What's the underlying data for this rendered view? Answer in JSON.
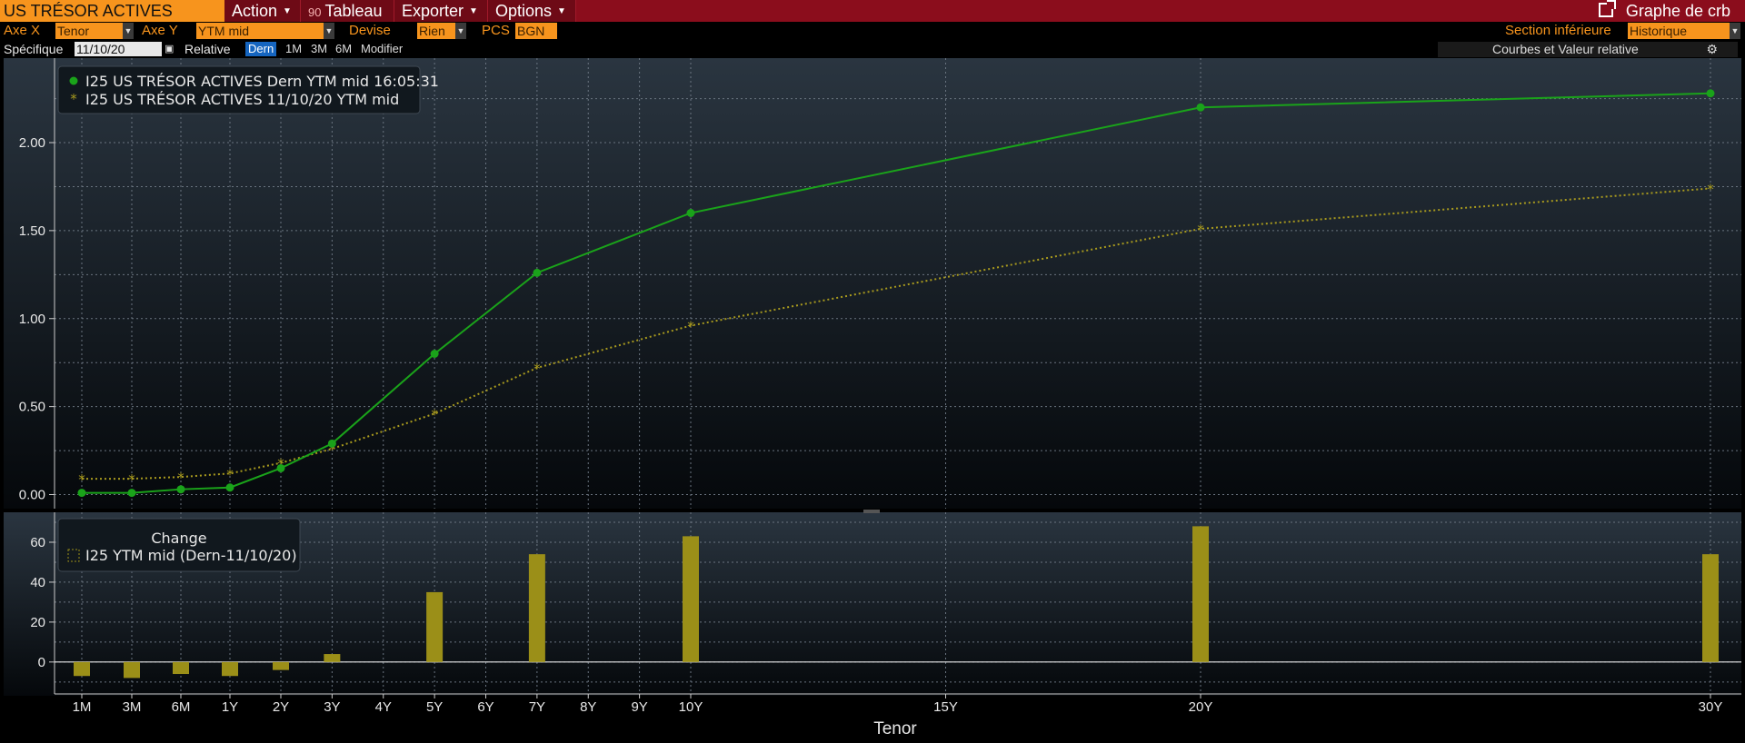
{
  "app": {
    "title": "US TRÉSOR ACTIVES",
    "menu": [
      {
        "label": "Action",
        "caret": true
      },
      {
        "label": "Tableau",
        "prefix": "90",
        "caret": false
      },
      {
        "label": "Exporter",
        "caret": true
      },
      {
        "label": "Options",
        "caret": true
      }
    ],
    "graph_link": "Graphe de crb"
  },
  "controls": {
    "axe_x_label": "Axe X",
    "axe_x_value": "Tenor",
    "axe_y_label": "Axe Y",
    "axe_y_value": "YTM mid",
    "devise_label": "Devise",
    "devise_value": "Rien",
    "pcs_label": "PCS",
    "pcs_value": "BGN",
    "section_label": "Section inférieure",
    "section_value": "Historique",
    "specifique_label": "Spécifique",
    "date_value": "11/10/20",
    "relative_label": "Relative",
    "relative_options": [
      "Dern",
      "1M",
      "3M",
      "6M",
      "Modifier"
    ],
    "relative_selected": "Dern",
    "collapse_glyph": "«",
    "right_panel_label": "Courbes et Valeur relative",
    "gear_icon": "gear-icon"
  },
  "colors": {
    "series_current": "#1aa31a",
    "series_historic": "#a89a1e",
    "bars": "#9b8f18",
    "accent": "#f7941d",
    "titlebar": "#8b0d1c"
  },
  "chart_data": [
    {
      "type": "line",
      "x": [
        "1M",
        "3M",
        "6M",
        "1Y",
        "2Y",
        "3Y",
        "5Y",
        "7Y",
        "10Y",
        "20Y",
        "30Y"
      ],
      "x_years": [
        0.0833,
        0.25,
        0.5,
        1,
        2,
        3,
        5,
        7,
        10,
        20,
        30
      ],
      "series": [
        {
          "name": "I25 US TRÉSOR ACTIVES Dern YTM mid 16:05:31",
          "marker": "dot",
          "line": "solid",
          "values": [
            0.01,
            0.01,
            0.03,
            0.04,
            0.15,
            0.29,
            0.8,
            1.26,
            1.6,
            2.2,
            2.28
          ]
        },
        {
          "name": "I25 US TRÉSOR ACTIVES 11/10/20 YTM mid",
          "marker": "star",
          "line": "dotted",
          "values": [
            0.09,
            0.09,
            0.1,
            0.12,
            0.18,
            0.26,
            0.46,
            0.72,
            0.96,
            1.51,
            1.74
          ]
        }
      ],
      "yticks": [
        "0.00",
        "0.50",
        "1.00",
        "1.50",
        "2.00"
      ],
      "ylim": [
        -0.08,
        2.48
      ],
      "grid": true,
      "legend_position": "top-left"
    },
    {
      "type": "bar",
      "title": "Change",
      "legend": "I25 YTM mid (Dern-11/10/20)",
      "x": [
        "1M",
        "3M",
        "6M",
        "1Y",
        "2Y",
        "3Y",
        "5Y",
        "7Y",
        "10Y",
        "20Y",
        "30Y"
      ],
      "values": [
        -7,
        -8,
        -6,
        -7,
        -4,
        4,
        35,
        54,
        63,
        68,
        54
      ],
      "yticks": [
        "0",
        "20",
        "40",
        "60"
      ],
      "ylim": [
        -16,
        75
      ],
      "xlabel": "Tenor",
      "xticks": [
        "1M",
        "3M",
        "6M",
        "1Y",
        "2Y",
        "3Y",
        "4Y",
        "5Y",
        "6Y",
        "7Y",
        "8Y",
        "9Y",
        "10Y",
        "15Y",
        "20Y",
        "30Y"
      ],
      "grid": true,
      "legend_position": "top-left"
    }
  ]
}
